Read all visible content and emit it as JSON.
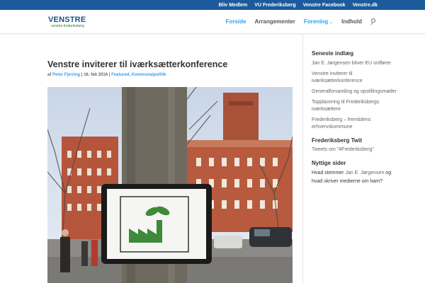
{
  "topbar": {
    "links": [
      "Bliv Medlem",
      "VU Frederiksberg",
      "Venstre Facebook",
      "Venstre.dk"
    ]
  },
  "header": {
    "logo_main": "VENSTRE",
    "logo_sub": "venstre frederiksberg",
    "nav": {
      "forside": "Forside",
      "arrangementer": "Arrangementer",
      "forening": "Forening",
      "indhold": "Indhold"
    }
  },
  "post": {
    "title": "Venstre inviterer til iværksætterkonference",
    "meta_prefix": "af",
    "author": "Peter Fjerring",
    "sep1": "|",
    "date": "16. feb 2016",
    "sep2": "|",
    "category1": "Featured",
    "comma": ",",
    "category2": "Kommunalpolitik"
  },
  "sidebar": {
    "recent_title": "Seneste indlæg",
    "recent": [
      "Jan E. Jørgensen bliver EU ordfører",
      "Venstre inviterer til iværksætterkonference",
      "Generalforsamling og opstillingsmøder",
      "Topplacering til Frederiksbergs iværksættere",
      "Frederiksberg – fremtidens erhvervskommune"
    ],
    "twitter_title": "Frederiksberg Twit",
    "twitter_text": "Tweets om \"#Frederiksberg\"",
    "pages_title": "Nyttige sider",
    "pages_line1": "Hvad stemmer",
    "pages_link": "Jan E. Jørgensen",
    "pages_line2": "og hvad skriver medierne om ham?"
  },
  "colors": {
    "topbar": "#1b5b9c",
    "accent": "#2ea3f2",
    "logo": "#1d4f86"
  }
}
